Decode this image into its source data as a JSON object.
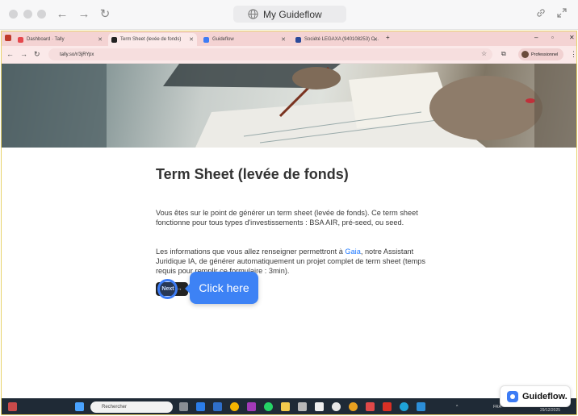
{
  "guideflow_frame": {
    "url_label": "My Guideflow"
  },
  "browser": {
    "tabs": [
      {
        "label": "Dashboard · Tally",
        "active": false,
        "icon_color": "#e5484d"
      },
      {
        "label": "Term Sheet (levée de fonds)",
        "active": true,
        "icon_color": "#222222"
      },
      {
        "label": "Guideflow",
        "active": false,
        "icon_color": "#3d7cf5"
      },
      {
        "label": "Société LEGAXA (940108253) C...",
        "active": false,
        "icon_color": "#2b4a9a"
      }
    ],
    "address": "tally.so/r/3jRYpx",
    "profile_label": "Professionnel"
  },
  "page": {
    "title": "Term Sheet (levée de fonds)",
    "paragraph1": "Vous êtes sur le point de générer un term sheet (levée de fonds). Ce term sheet fonctionne pour tous types d'investissements : BSA AIR, pré-seed, ou seed.",
    "paragraph2_before": "Les informations que vous allez renseigner permettront à ",
    "paragraph2_link": "Gaia",
    "paragraph2_after": ", notre Assistant Juridique IA, de générer automatiquement un projet complet de term sheet (temps requis pour remplir ce formulaire : 3min).",
    "next_label": "Next"
  },
  "callout": {
    "text": "Click here"
  },
  "taskbar": {
    "search_placeholder": "Rechercher",
    "lang": "FRA",
    "date": "29/12/2025"
  },
  "badge": {
    "label": "Guideflow."
  }
}
